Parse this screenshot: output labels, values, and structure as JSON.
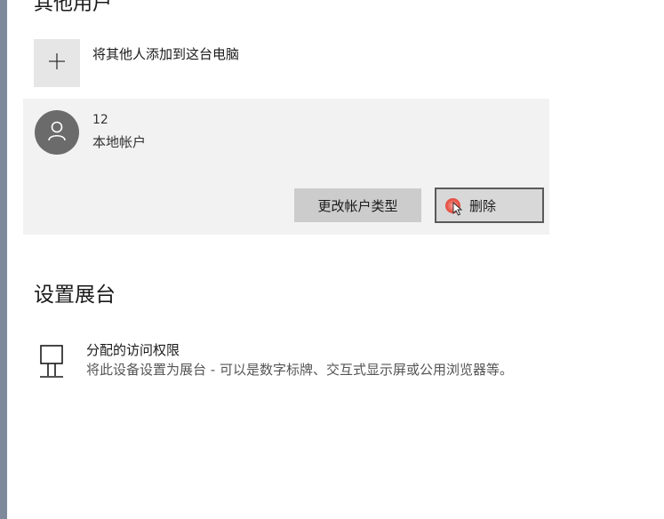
{
  "other_users": {
    "section_title": "其他用户",
    "add_label": "将其他人添加到这台电脑"
  },
  "account": {
    "name": "12",
    "type": "本地帐户",
    "change_type_label": "更改帐户类型",
    "delete_label": "删除"
  },
  "kiosk": {
    "section_title": "设置展台",
    "item_title": "分配的访问权限",
    "item_desc": "将此设备设置为展台 - 可以是数字标牌、交互式显示屏或公用浏览器等。"
  },
  "icons": {
    "add": "plus-icon",
    "avatar": "person-icon",
    "kiosk": "kiosk-monitor-icon",
    "cursor": "mouse-pointer-icon"
  },
  "colors": {
    "panel_bg": "#f2f2f2",
    "button_bg": "#cccccc",
    "avatar_bg": "#6b6b6b",
    "click_highlight": "#e8574a"
  }
}
